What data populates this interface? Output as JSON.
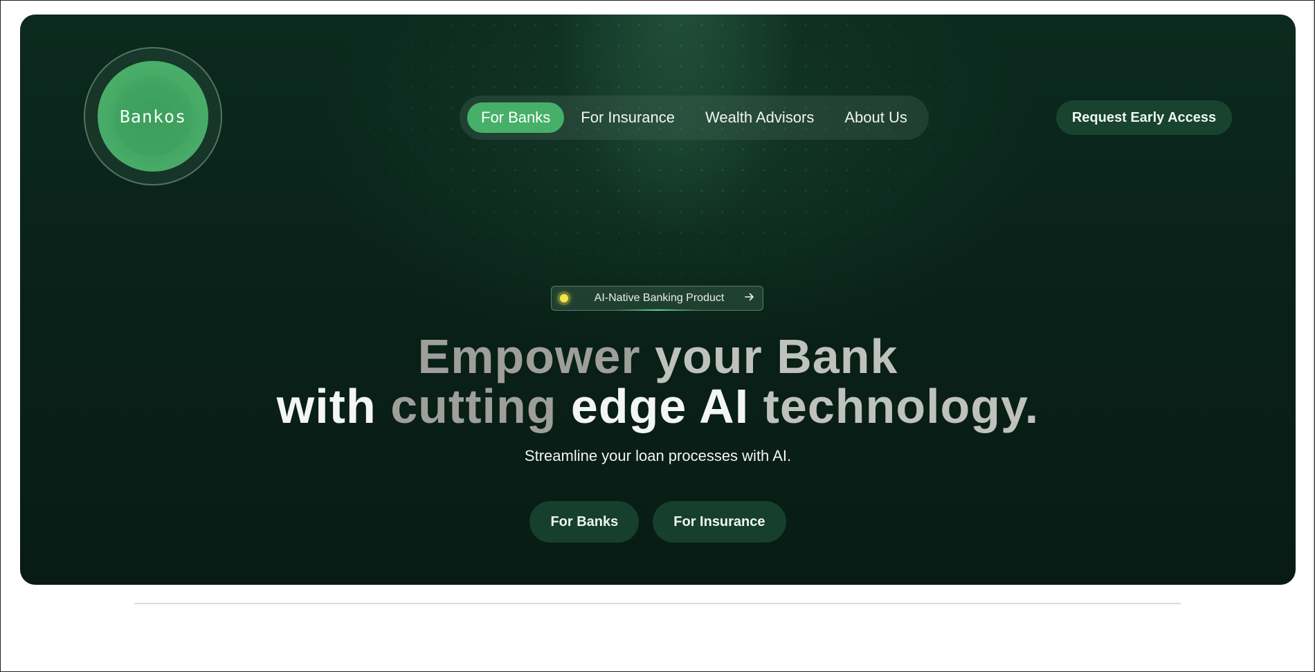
{
  "brand": {
    "name": "Bankos"
  },
  "nav": {
    "items": [
      {
        "label": "For Banks",
        "active": true
      },
      {
        "label": "For Insurance",
        "active": false
      },
      {
        "label": "Wealth Advisors",
        "active": false
      },
      {
        "label": "About Us",
        "active": false
      }
    ]
  },
  "header": {
    "cta_label": "Request Early Access"
  },
  "badge": {
    "label": "AI-Native Banking Product",
    "icon": "arrow-right-icon"
  },
  "hero": {
    "headline_line1": [
      "Empower",
      "your",
      "Bank"
    ],
    "headline_line2": [
      "with",
      "cutting",
      "edge",
      "AI",
      "technology."
    ],
    "subhead": "Streamline your loan processes with AI.",
    "buttons": [
      "For Banks",
      "For Insurance"
    ]
  },
  "colors": {
    "hero_bg": "#092018",
    "accent_green": "#46b068",
    "button_bg": "#16402d"
  }
}
